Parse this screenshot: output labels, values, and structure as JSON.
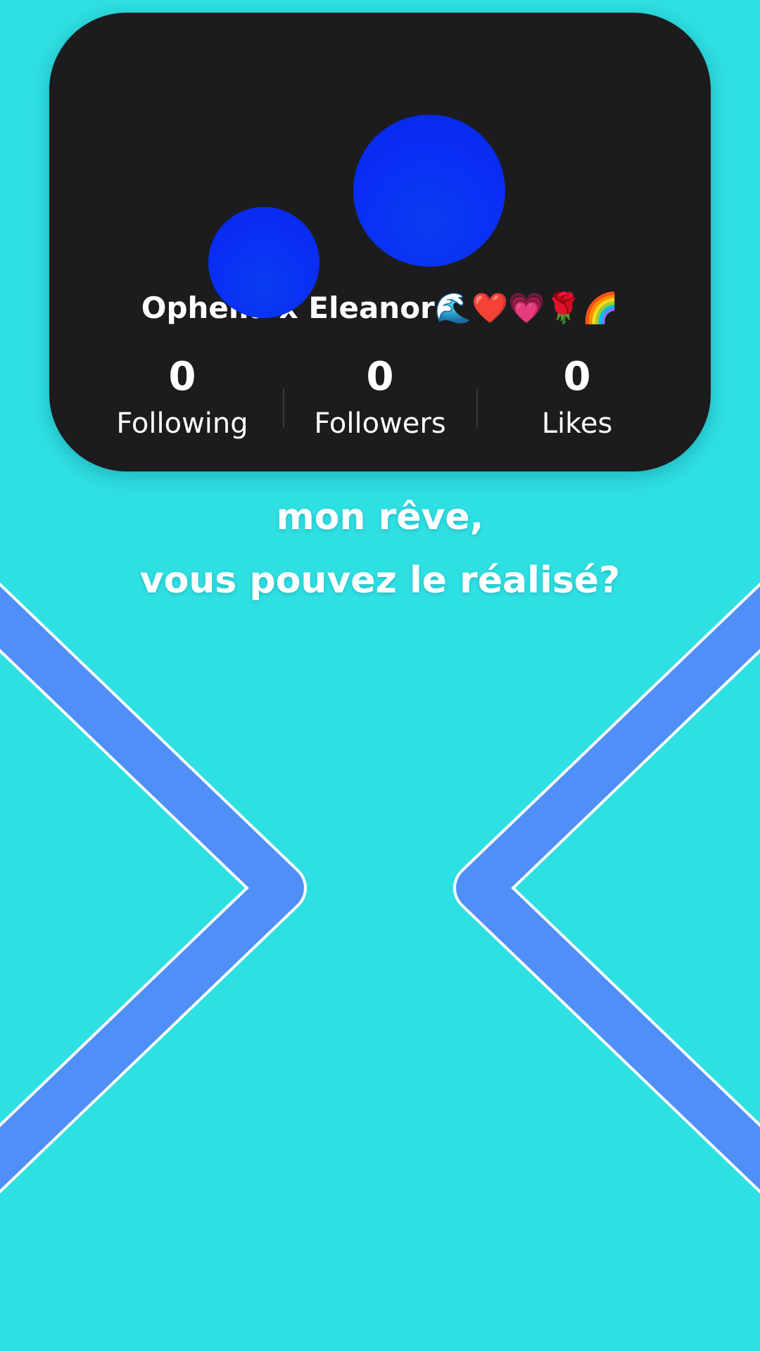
{
  "profile": {
    "username": "Ophelia x Eleanor🌊❤️💗🌹🌈",
    "stats": [
      {
        "value": "0",
        "label": "Following"
      },
      {
        "value": "0",
        "label": "Followers"
      },
      {
        "value": "0",
        "label": "Likes"
      }
    ]
  },
  "caption": {
    "line1": "mon rêve,",
    "line2": "vous pouvez le réalisé?"
  },
  "colors": {
    "background": "#2fe0e3",
    "card": "#1c1c1e",
    "avatar": "#0a2ef5",
    "chevron": "#4f8ff7"
  },
  "icons": {
    "left": "chevron-right-icon",
    "right": "chevron-left-icon"
  }
}
